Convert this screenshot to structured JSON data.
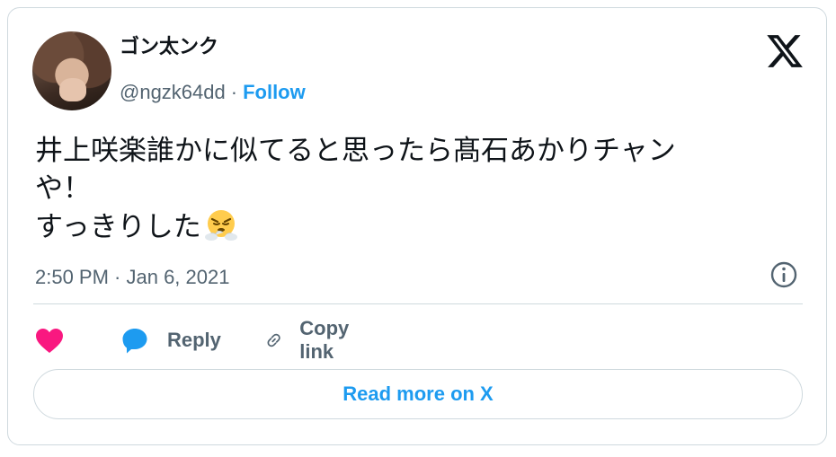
{
  "author": {
    "display_name": "ゴン太ンク",
    "handle": "@ngzk64dd",
    "separator": "·",
    "follow_label": "Follow"
  },
  "tweet": {
    "lines": [
      "井上咲楽誰かに似てると思ったら髙石あかりチャン",
      "や！",
      "すっきりした"
    ],
    "emoji": "face-with-steam-from-nose",
    "timestamp": "2:50 PM · Jan 6, 2021"
  },
  "actions": {
    "reply_label": "Reply",
    "copy_label": "Copy link"
  },
  "read_more_label": "Read more on X",
  "colors": {
    "accent": "#1d9bf0",
    "heart": "#f91880",
    "muted_text": "#536471",
    "border": "#cfd9de"
  }
}
